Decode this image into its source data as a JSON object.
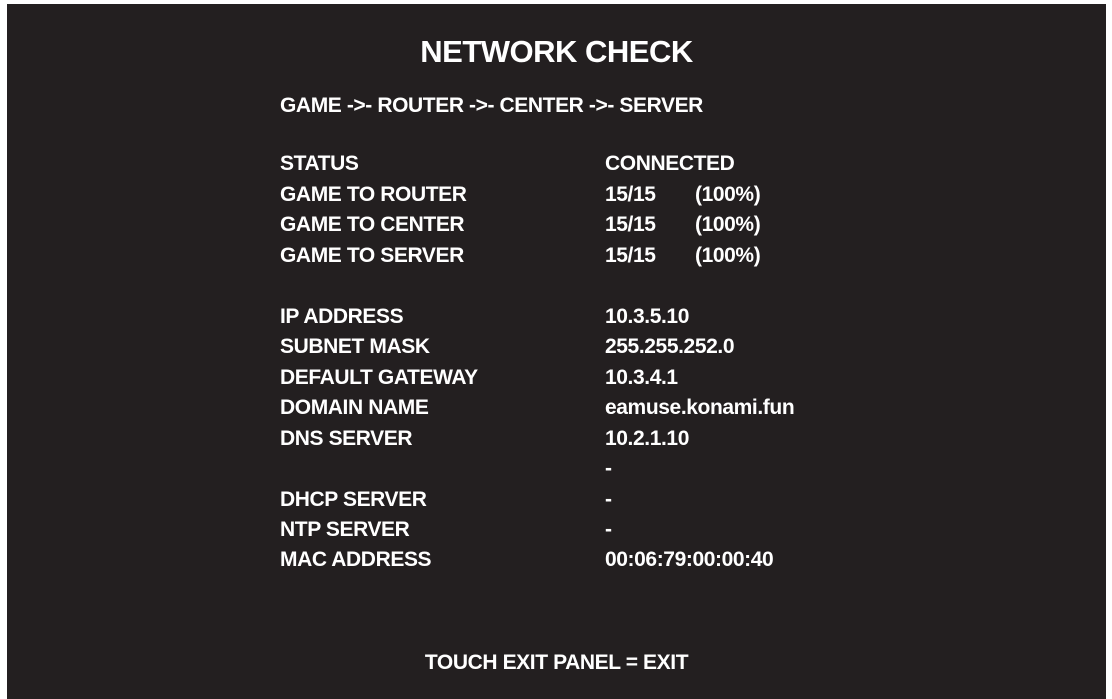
{
  "screen": {
    "title": "NETWORK CHECK",
    "route": "GAME ->- ROUTER ->- CENTER ->- SERVER",
    "footer": "TOUCH EXIT PANEL = EXIT"
  },
  "status": [
    {
      "label": "STATUS",
      "value": "CONNECTED",
      "percent": ""
    },
    {
      "label": "GAME TO ROUTER",
      "value": "15/15",
      "percent": "(100%)"
    },
    {
      "label": "GAME TO CENTER",
      "value": "15/15",
      "percent": "(100%)"
    },
    {
      "label": "GAME TO SERVER",
      "value": "15/15",
      "percent": "(100%)"
    }
  ],
  "network": [
    {
      "label": "IP ADDRESS",
      "value": "10.3.5.10"
    },
    {
      "label": "SUBNET MASK",
      "value": "255.255.252.0"
    },
    {
      "label": "DEFAULT GATEWAY",
      "value": "10.3.4.1"
    },
    {
      "label": "DOMAIN NAME",
      "value": "eamuse.konami.fun"
    },
    {
      "label": "DNS SERVER",
      "value": "10.2.1.10"
    },
    {
      "label": "",
      "value": "-"
    },
    {
      "label": "DHCP SERVER",
      "value": "-"
    },
    {
      "label": "NTP SERVER",
      "value": "-"
    },
    {
      "label": "MAC ADDRESS",
      "value": "00:06:79:00:00:40"
    }
  ]
}
